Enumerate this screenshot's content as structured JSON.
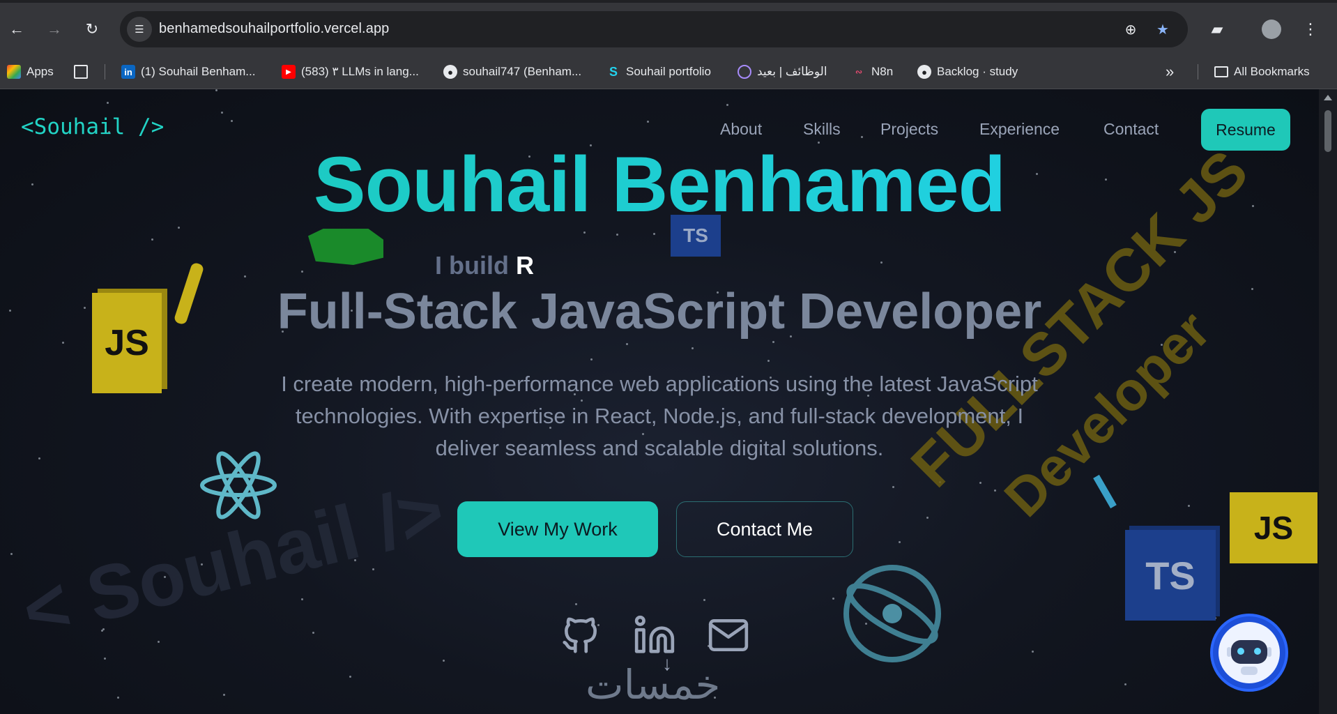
{
  "browser": {
    "url": "benhamedsouhailportfolio.vercel.app",
    "bookmarks": [
      {
        "label": "Apps",
        "icon": "apps-grid-icon"
      },
      {
        "label": "",
        "icon": "grid-icon"
      },
      {
        "label": "(1) Souhail Benham...",
        "icon": "linkedin-icon"
      },
      {
        "label": "(583) ٣ LLMs in lang...",
        "icon": "youtube-icon"
      },
      {
        "label": "souhail747 (Benham...",
        "icon": "github-icon"
      },
      {
        "label": "Souhail portfolio",
        "icon": "s-logo-icon"
      },
      {
        "label": "الوظائف | بعيد",
        "icon": "radar-icon"
      },
      {
        "label": "N8n",
        "icon": "n8n-icon"
      },
      {
        "label": "Backlog · study",
        "icon": "github-icon"
      }
    ],
    "all_bookmarks": "All Bookmarks"
  },
  "site": {
    "logo": "<Souhail />",
    "nav": [
      "About",
      "Skills",
      "Projects",
      "Experience",
      "Contact"
    ],
    "resume": "Resume",
    "name": "Souhail Benhamed",
    "typing_prefix": "I build",
    "typing_char": "R",
    "role": "Full-Stack JavaScript Developer",
    "bio": "I create modern, high-performance web applications using the latest JavaScript technologies. With expertise in React, Node.js, and full-stack development, I deliver seamless and scalable digital solutions.",
    "cta_primary": "View My Work",
    "cta_secondary": "Contact Me",
    "watermark": "< Souhail />",
    "deco_line1": "FULLSTACK JS",
    "deco_line2": "Developer",
    "badge_js": "JS",
    "badge_ts": "TS",
    "bottom_arabic": "خمسات",
    "socials": [
      "github-icon",
      "linkedin-icon",
      "mail-icon"
    ]
  },
  "colors": {
    "accent": "#1fc8b8",
    "accent2": "#22d3ee",
    "deco_gold": "#6b5d12",
    "js_yellow": "#c8b21a",
    "ts_blue": "#1c3f8c"
  }
}
